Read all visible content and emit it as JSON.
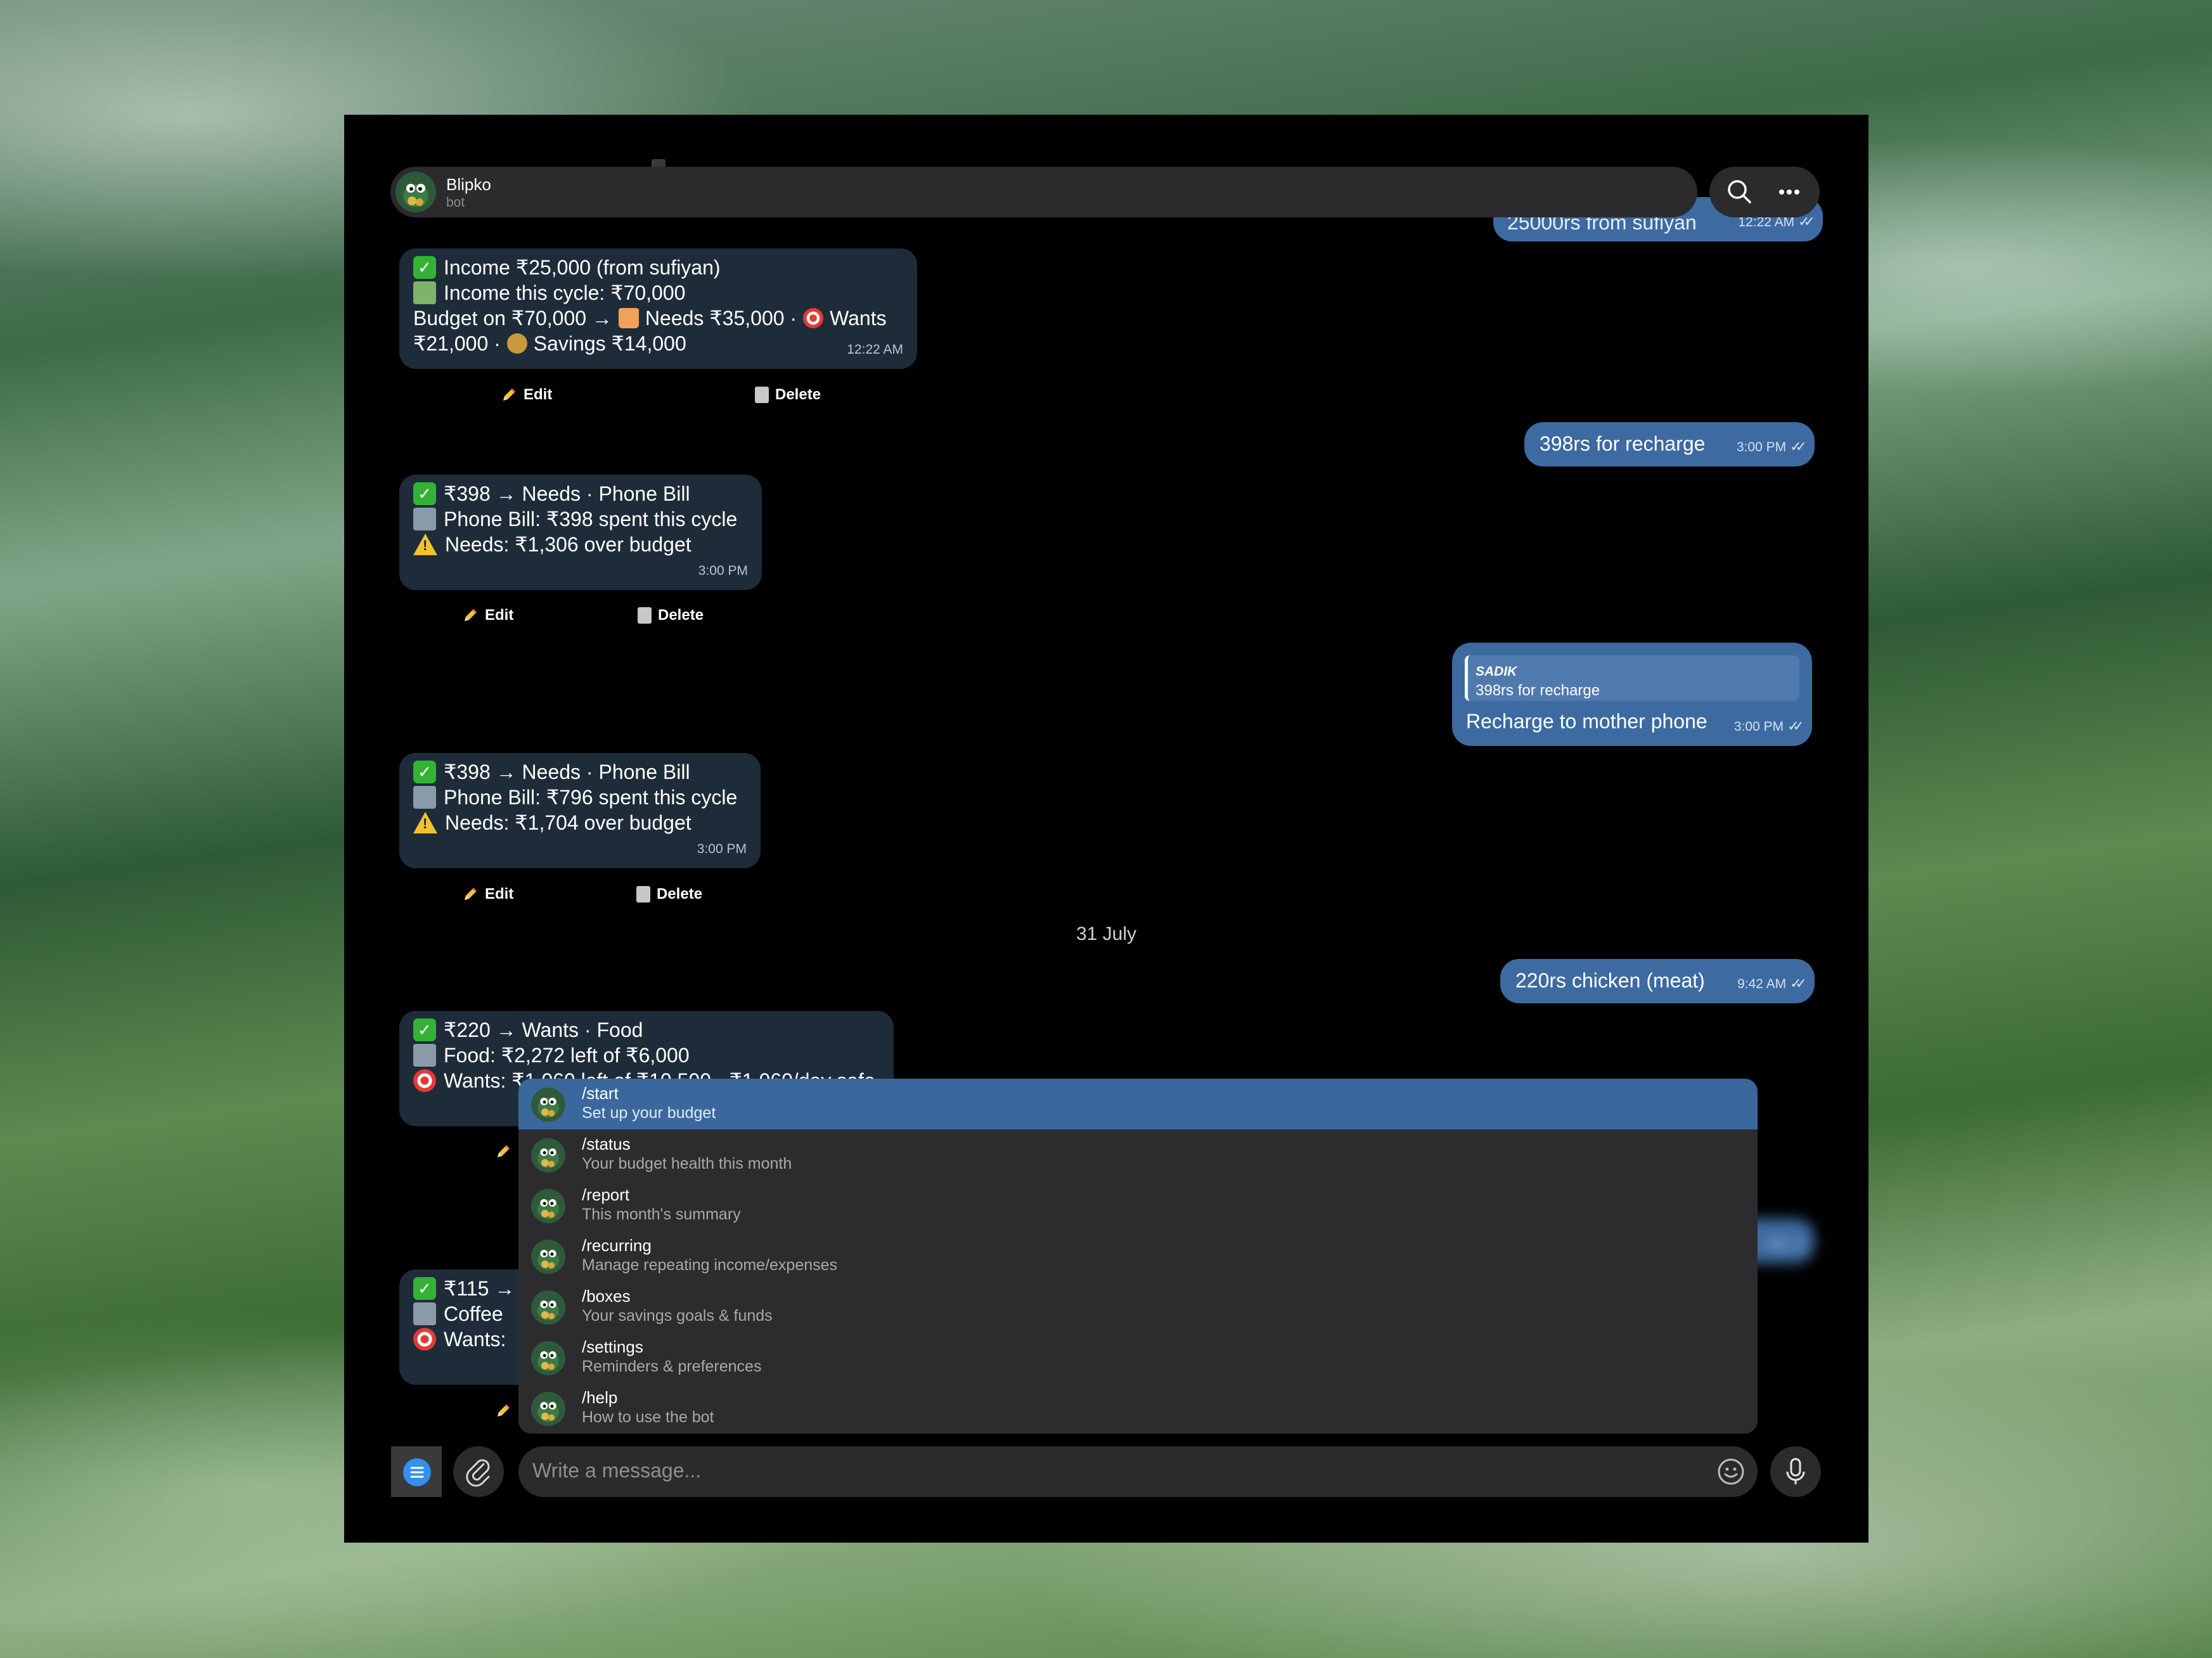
{
  "chat": {
    "name": "Blipko",
    "subtitle": "bot"
  },
  "messages": {
    "out_top": {
      "text": "25000rs from sufiyan",
      "time": "12:22 AM"
    },
    "bot1": {
      "l1": "Income ₹25,000 (from sufiyan)",
      "l2": "Income this cycle: ₹70,000",
      "l3a": "Budget on ₹70,000 →",
      "l3b": "Needs ₹35,000 ·",
      "l3c": "Wants",
      "l4a": "₹21,000 ·",
      "l4b": "Savings ₹14,000",
      "time": "12:22 AM"
    },
    "out2": {
      "text": "398rs for recharge",
      "time": "3:00 PM"
    },
    "bot2": {
      "l1": "₹398 → Needs · Phone Bill",
      "l2": "Phone Bill: ₹398 spent this cycle",
      "l3": "Needs: ₹1,306 over budget",
      "time": "3:00 PM"
    },
    "out3": {
      "reply_name": "SADIK",
      "reply_text": "398rs for recharge",
      "text": "Recharge to mother phone",
      "time": "3:00 PM"
    },
    "bot3": {
      "l1": "₹398 → Needs · Phone Bill",
      "l2": "Phone Bill: ₹796 spent this cycle",
      "l3": "Needs: ₹1,704 over budget",
      "time": "3:00 PM"
    },
    "date_sep": "31 July",
    "out4": {
      "text": "220rs chicken (meat)",
      "time": "9:42 AM"
    },
    "bot4": {
      "l1": "₹220 → Wants · Food",
      "l2": "Food: ₹2,272 left of ₹6,000",
      "l3": "Wants: ₹1,060 left of ₹10,500 · ₹1,060/day safe"
    },
    "out5": {
      "time": "AM"
    },
    "bot5": {
      "l1": "₹115 →",
      "l2": "Coffee",
      "l3": "Wants:"
    }
  },
  "buttons": {
    "edit": "Edit",
    "delete": "Delete"
  },
  "commands": [
    {
      "name": "/start",
      "desc": "Set up your budget"
    },
    {
      "name": "/status",
      "desc": "Your budget health this month"
    },
    {
      "name": "/report",
      "desc": "This month's summary"
    },
    {
      "name": "/recurring",
      "desc": "Manage repeating income/expenses"
    },
    {
      "name": "/boxes",
      "desc": "Your savings goals & funds"
    },
    {
      "name": "/settings",
      "desc": "Reminders & preferences"
    },
    {
      "name": "/help",
      "desc": "How to use the bot"
    }
  ],
  "composer": {
    "placeholder": "Write a message..."
  },
  "colors": {
    "accent": "#3390ec",
    "out_bubble": "#3d6aa0",
    "in_bubble": "#1e2c3a",
    "selected_cmd": "#3a689c"
  },
  "icons": [
    "avatar-bot",
    "search-icon",
    "more-icon",
    "check-emoji",
    "folder-emoji",
    "warning-emoji",
    "dart-emoji",
    "money-emoji",
    "house-emoji",
    "moneybag-emoji",
    "pencil-icon",
    "trash-icon",
    "menu-icon",
    "paperclip-icon",
    "emoji-icon",
    "mic-icon"
  ]
}
